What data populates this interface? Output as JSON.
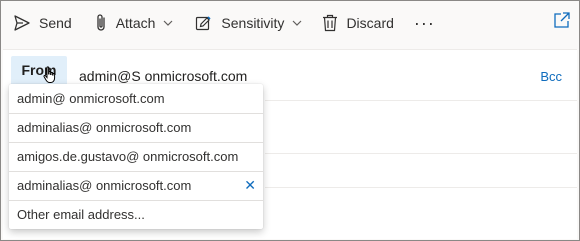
{
  "toolbar": {
    "send_label": "Send",
    "attach_label": "Attach",
    "sensitivity_label": "Sensitivity",
    "discard_label": "Discard",
    "more_label": "···"
  },
  "compose": {
    "from_label": "From",
    "from_value": "admin@S       onmicrosoft.com",
    "bcc_label": "Bcc"
  },
  "from_dropdown": {
    "items": [
      "admin@              onmicrosoft.com",
      "adminalias@              onmicrosoft.com",
      "amigos.de.gustavo@              onmicrosoft.com",
      "adminalias@              onmicrosoft.com"
    ],
    "other_label": "Other email address...",
    "remove_glyph": "✕"
  },
  "colors": {
    "accent": "#0f6cbd",
    "from_button_bg": "#e1effa",
    "toolbar_bg": "#faf9f8"
  }
}
